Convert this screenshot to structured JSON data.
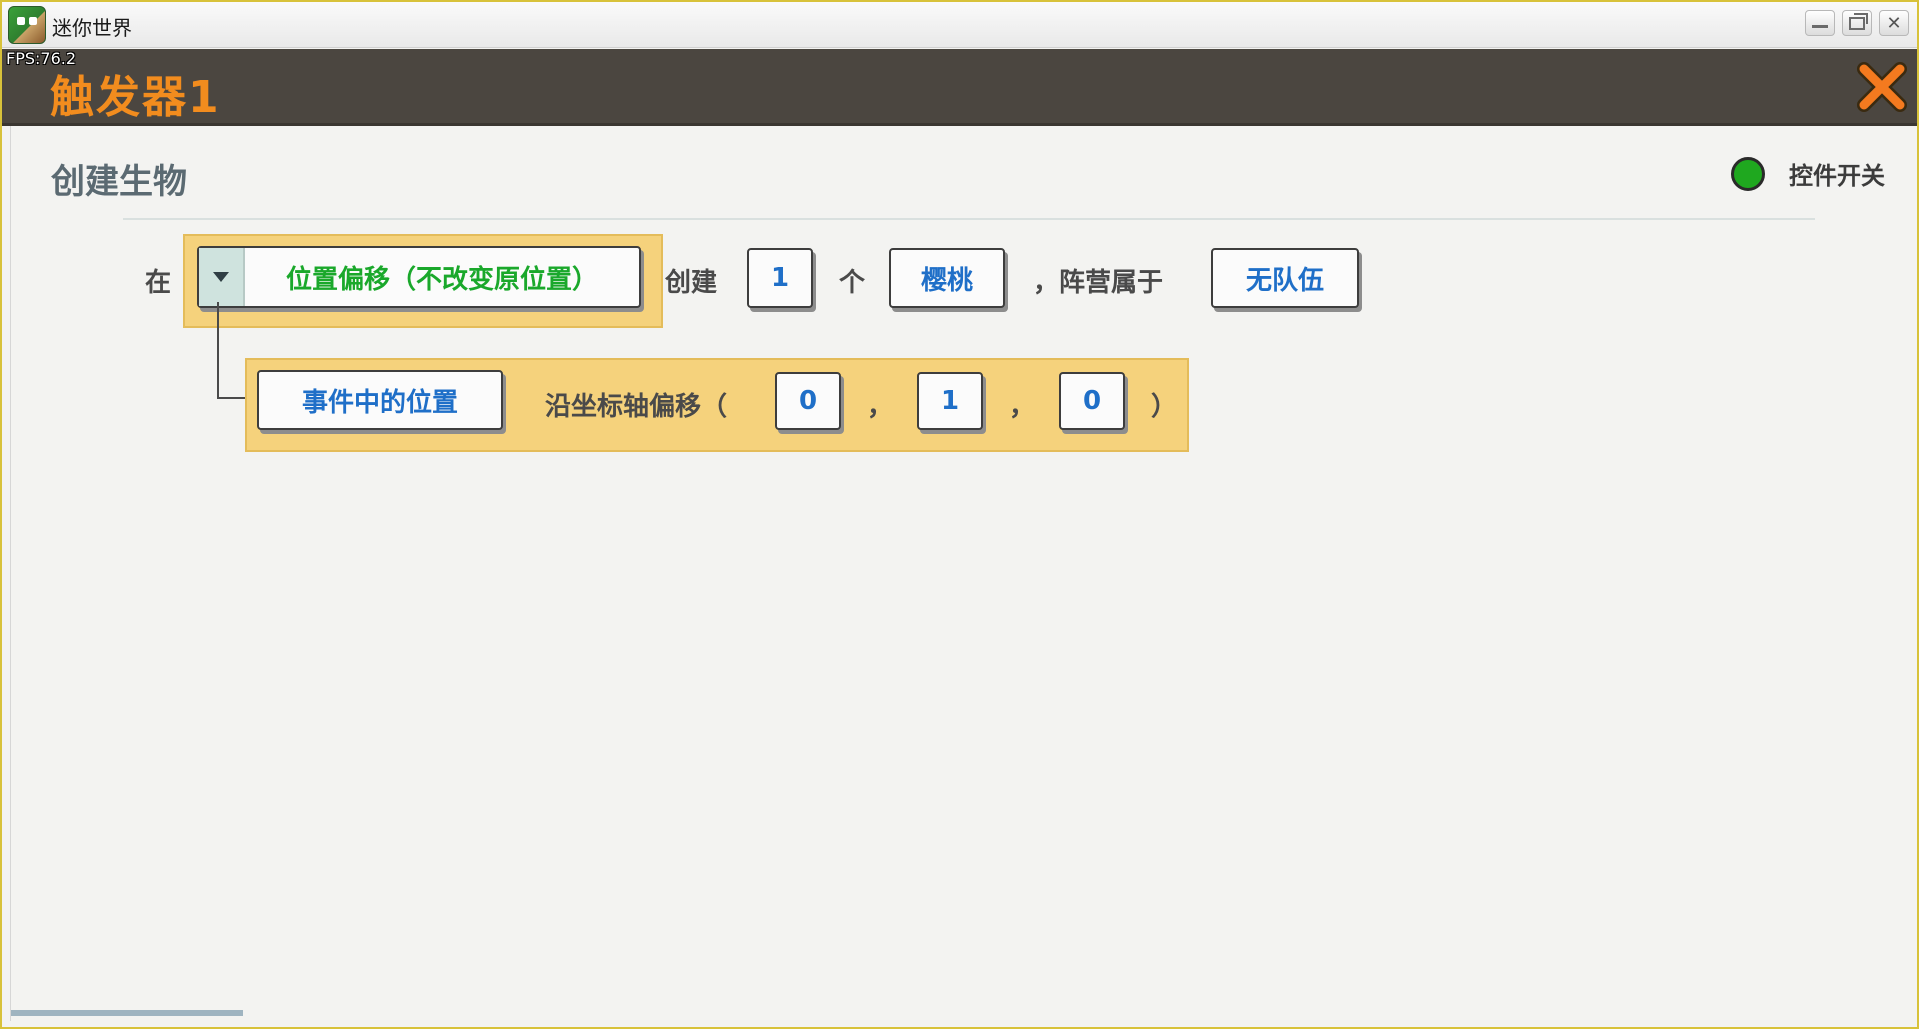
{
  "window": {
    "app_title": "迷你世界",
    "fps": "FPS:76.2",
    "buttons": {
      "minimize": "minimize-icon",
      "maximize": "maximize-icon",
      "close": "close-icon"
    }
  },
  "dialog": {
    "title": "触发器1",
    "close_icon": "close-x-icon",
    "accent_color": "#f28c1e"
  },
  "section": {
    "title": "创建生物",
    "toggle_label": "控件开关",
    "toggle_on": true,
    "toggle_color": "#1fa81f"
  },
  "statement": {
    "at_label": "在",
    "position_dropdown": "位置偏移（不改变原位置）",
    "create_label": "创建",
    "count": "1",
    "unit_label": "个",
    "creature": "樱桃",
    "faction_label": "，阵营属于",
    "team": "无队伍"
  },
  "sub_statement": {
    "position_source": "事件中的位置",
    "offset_label": "沿坐标轴偏移（",
    "x": "0",
    "sep1": "，",
    "y": "1",
    "sep2": "，",
    "z": "0",
    "close_paren": "）"
  }
}
